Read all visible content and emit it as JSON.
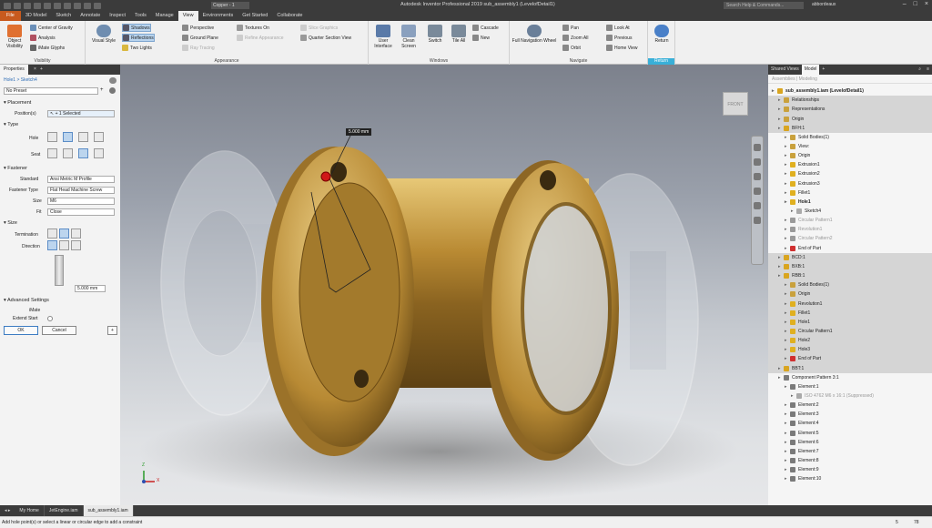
{
  "app": {
    "title": "Autodesk Inventor Professional 2019    sub_assembly1 (LevelofDetail1)",
    "search_placeholder": "Search Help & Commands...",
    "user": "abbordeaux",
    "active_doc_dropdown": "Copper - 1"
  },
  "tabs": [
    "File",
    "3D Model",
    "Sketch",
    "Annotate",
    "Inspect",
    "Tools",
    "Manage",
    "View",
    "Environments",
    "Get Started",
    "Collaborate"
  ],
  "active_tab": "View",
  "ribbon": {
    "visibility": {
      "label": "Visibility",
      "object_visibility": "Object Visibility",
      "center_of_gravity": "Center of Gravity",
      "analysis": "Analysis",
      "ifeature_glyphs": "iMate Glyphs"
    },
    "appearance": {
      "label": "Appearance",
      "visual_style": "Visual Style",
      "shadows": "Shadows",
      "reflections": "Reflections",
      "two_lights": "Two Lights",
      "perspective": "Perspective",
      "ground_plane": "Ground Plane",
      "ray_tracing": "Ray Tracing",
      "textures_on": "Textures On",
      "refine_appearance": "Refine Appearance",
      "slice_graphics": "Slice Graphics",
      "quarter_section_view": "Quarter Section View"
    },
    "windows": {
      "label": "Windows",
      "user_interface": "User Interface",
      "clean_screen": "Clean Screen",
      "switch": "Switch",
      "tile_all": "Tile All",
      "cascade": "Cascade",
      "new": "New"
    },
    "navigate": {
      "label": "Navigate",
      "full_navigation_wheel": "Full Navigation Wheel",
      "pan": "Pan",
      "zoom_all": "Zoom All",
      "orbit": "Orbit",
      "look_at": "Look At",
      "previous": "Previous",
      "home_view": "Home View"
    },
    "return": {
      "label": "Return",
      "return": "Return"
    }
  },
  "properties": {
    "tab_label": "Properties",
    "breadcrumb": "Hole1 > Sketch4",
    "preset": "No Preset",
    "placement_header": "Placement",
    "positions_label": "Position(s)",
    "positions_value": "1 Selected",
    "type_header": "Type",
    "hole_label": "Hole",
    "seat_label": "Seat",
    "fastener_header": "Fastener",
    "standard_label": "Standard",
    "standard_value": "Ansi Metric M Profile",
    "fastener_type_label": "Fastener Type",
    "fastener_type_value": "Flat Head Machine Screw",
    "size_label": "Size",
    "size_value": "M6",
    "fit_label": "Fit",
    "fit_value": "Close",
    "size_header": "Size",
    "termination_label": "Termination",
    "direction_label": "Direction",
    "depth_value": "5.000 mm",
    "advanced_header": "Advanced Settings",
    "ipmate_label": "iMate",
    "extend_start_label": "Extend Start",
    "ok": "OK",
    "cancel": "Cancel"
  },
  "viewport": {
    "dimension_label": "5.000 mm",
    "viewcube_label": "FRONT",
    "axis_x": "X",
    "axis_z": "Z"
  },
  "browser": {
    "tabs": [
      "Shared Views",
      "Model"
    ],
    "active_tab": "Model",
    "subheader": "Assemblies  |  Modeling",
    "rows": [
      {
        "label": "sub_assembly1.iam (LevelofDetail1)",
        "indent": 0,
        "style": "bold",
        "icon": "#d9a520"
      },
      {
        "label": "Relationships",
        "indent": 1,
        "style": "hl",
        "icon": "#c9a13d"
      },
      {
        "label": "Representations",
        "indent": 1,
        "style": "hl",
        "icon": "#c9a13d"
      },
      {
        "label": "Origin",
        "indent": 1,
        "style": "hl",
        "icon": "#c9a13d"
      },
      {
        "label": "BFH:1",
        "indent": 1,
        "style": "hl",
        "icon": "#d9a520"
      },
      {
        "label": "Solid Bodies(1)",
        "indent": 2,
        "style": "",
        "icon": "#c9a13d"
      },
      {
        "label": "View:",
        "indent": 2,
        "style": "",
        "icon": "#c9a13d"
      },
      {
        "label": "Origin",
        "indent": 2,
        "style": "",
        "icon": "#c9a13d"
      },
      {
        "label": "Extrusion1",
        "indent": 2,
        "style": "",
        "icon": "#e0b020"
      },
      {
        "label": "Extrusion2",
        "indent": 2,
        "style": "",
        "icon": "#e0b020"
      },
      {
        "label": "Extrusion3",
        "indent": 2,
        "style": "",
        "icon": "#e0b020"
      },
      {
        "label": "Fillet1",
        "indent": 2,
        "style": "",
        "icon": "#e0b020"
      },
      {
        "label": "Hole1",
        "indent": 2,
        "style": "bold",
        "icon": "#e0b020"
      },
      {
        "label": "Sketch4",
        "indent": 3,
        "style": "",
        "icon": "#aaaaaa"
      },
      {
        "label": "Circular Pattern1",
        "indent": 2,
        "style": "dim",
        "icon": "#9a9a9a"
      },
      {
        "label": "Revolution1",
        "indent": 2,
        "style": "dim",
        "icon": "#9a9a9a"
      },
      {
        "label": "Circular Pattern2",
        "indent": 2,
        "style": "dim",
        "icon": "#9a9a9a"
      },
      {
        "label": "End of Part",
        "indent": 2,
        "style": "",
        "icon": "#d03030"
      },
      {
        "label": "BCD:1",
        "indent": 1,
        "style": "hl",
        "icon": "#d9a520"
      },
      {
        "label": "BXB:1",
        "indent": 1,
        "style": "hl",
        "icon": "#d9a520"
      },
      {
        "label": "RBB:1",
        "indent": 1,
        "style": "hl",
        "icon": "#d9a520"
      },
      {
        "label": "Solid Bodies(1)",
        "indent": 2,
        "style": "hl",
        "icon": "#c9a13d"
      },
      {
        "label": "Origin",
        "indent": 2,
        "style": "hl",
        "icon": "#c9a13d"
      },
      {
        "label": "Revolution1",
        "indent": 2,
        "style": "hl",
        "icon": "#e0b020"
      },
      {
        "label": "Fillet1",
        "indent": 2,
        "style": "hl",
        "icon": "#e0b020"
      },
      {
        "label": "Hole1",
        "indent": 2,
        "style": "hl",
        "icon": "#e0b020"
      },
      {
        "label": "Circular Pattern1",
        "indent": 2,
        "style": "hl",
        "icon": "#e0b020"
      },
      {
        "label": "Hole2",
        "indent": 2,
        "style": "hl",
        "icon": "#e0b020"
      },
      {
        "label": "Hole3",
        "indent": 2,
        "style": "hl",
        "icon": "#e0b020"
      },
      {
        "label": "End of Part",
        "indent": 2,
        "style": "hl",
        "icon": "#d03030"
      },
      {
        "label": "BBT:1",
        "indent": 1,
        "style": "hl",
        "icon": "#d9a520"
      },
      {
        "label": "Component Pattern 3:1",
        "indent": 1,
        "style": "",
        "icon": "#7a7a7a"
      },
      {
        "label": "Element:1",
        "indent": 2,
        "style": "",
        "icon": "#7a7a7a"
      },
      {
        "label": "ISO 4762 M6 x 16:1 (Suppressed)",
        "indent": 3,
        "style": "dim",
        "icon": "#aaaaaa"
      },
      {
        "label": "Element:2",
        "indent": 2,
        "style": "",
        "icon": "#7a7a7a"
      },
      {
        "label": "Element:3",
        "indent": 2,
        "style": "",
        "icon": "#7a7a7a"
      },
      {
        "label": "Element:4",
        "indent": 2,
        "style": "",
        "icon": "#7a7a7a"
      },
      {
        "label": "Element:5",
        "indent": 2,
        "style": "",
        "icon": "#7a7a7a"
      },
      {
        "label": "Element:6",
        "indent": 2,
        "style": "",
        "icon": "#7a7a7a"
      },
      {
        "label": "Element:7",
        "indent": 2,
        "style": "",
        "icon": "#7a7a7a"
      },
      {
        "label": "Element:8",
        "indent": 2,
        "style": "",
        "icon": "#7a7a7a"
      },
      {
        "label": "Element:9",
        "indent": 2,
        "style": "",
        "icon": "#7a7a7a"
      },
      {
        "label": "Element:10",
        "indent": 2,
        "style": "",
        "icon": "#7a7a7a"
      }
    ]
  },
  "doc_tabs": [
    "My Home",
    "JetEngine.iam",
    "sub_assembly1.iam"
  ],
  "active_doc_tab": "sub_assembly1.iam",
  "status": {
    "message": "Add hole point(s) or select a linear or circular edge to add a constraint",
    "count1": "5",
    "count2": "78"
  },
  "colors": {
    "file_tab": "#c85a1e",
    "ribbon_bg": "#f0f0f0",
    "brass": "#c9a13d",
    "selection": "#b9d4ee",
    "return_accent": "#39b0d8"
  }
}
